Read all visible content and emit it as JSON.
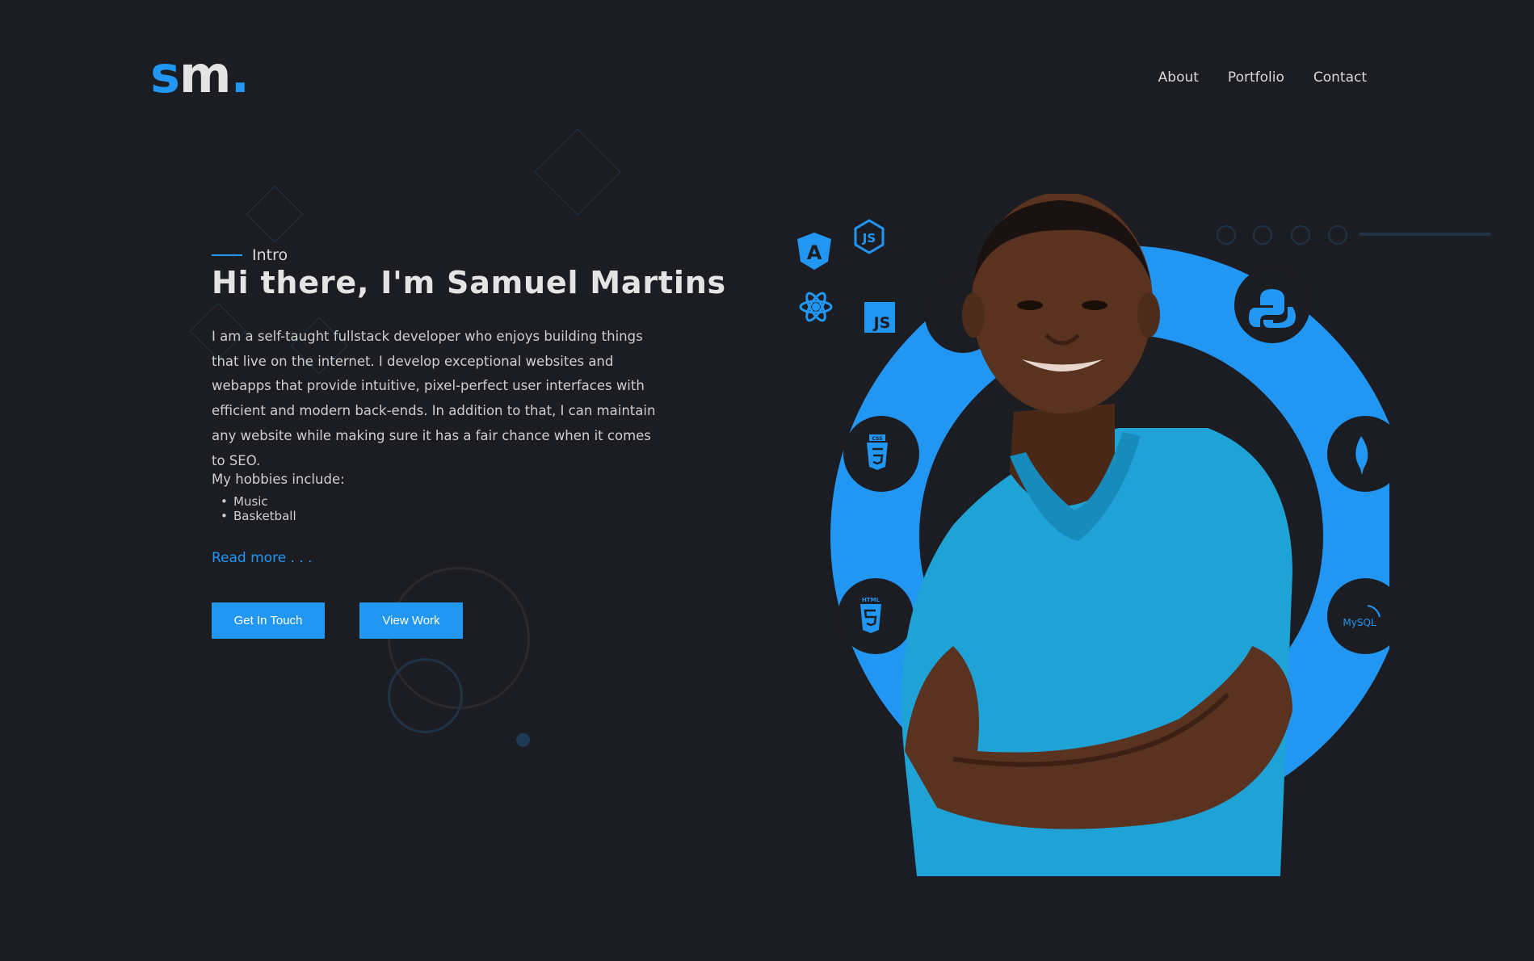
{
  "logo": {
    "s": "s",
    "m": "m",
    "dot": "."
  },
  "nav": [
    {
      "label": "About"
    },
    {
      "label": "Portfolio"
    },
    {
      "label": "Contact"
    }
  ],
  "intro_label": "Intro",
  "heading": "Hi there, I'm Samuel Martins",
  "bio": "I am a self-taught fullstack developer who enjoys building things that live on the internet. I develop exceptional websites and webapps that provide intuitive, pixel-perfect user interfaces with efficient and modern back-ends. In addition to that, I can maintain any website while making sure it has a fair chance when it comes to SEO.",
  "hobbies": {
    "title": "My hobbies include:",
    "items": [
      "Music",
      "Basketball"
    ]
  },
  "read_more": "Read more . . .",
  "buttons": {
    "touch": "Get In Touch",
    "work": "View Work"
  },
  "tech_icons": {
    "angular": "A",
    "nodejs": "JS",
    "js": "JS",
    "css": "CSS",
    "html": "HTML",
    "mysql": "MySQL"
  },
  "colors": {
    "accent": "#2196f3",
    "background": "#1c1d22",
    "shirt": "#1fa3d6",
    "skin": "#5a3320"
  }
}
